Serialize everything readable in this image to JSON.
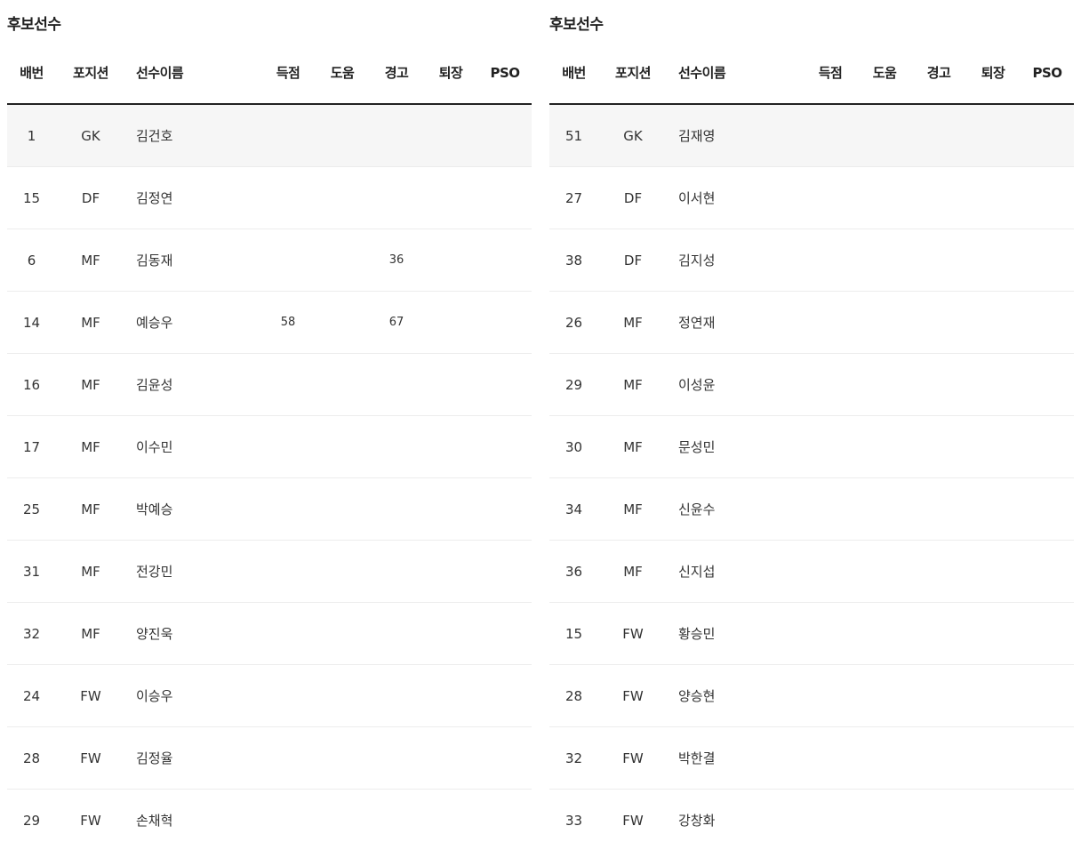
{
  "left": {
    "title": "후보선수",
    "columns": {
      "no": "배번",
      "position": "포지션",
      "name": "선수이름",
      "goal": "득점",
      "assist": "도움",
      "warning": "경고",
      "sendoff": "퇴장",
      "pso": "PSO"
    },
    "rows": [
      {
        "no": "1",
        "position": "GK",
        "name": "김건호",
        "goal": "",
        "assist": "",
        "warning": "",
        "sendoff": "",
        "pso": ""
      },
      {
        "no": "15",
        "position": "DF",
        "name": "김정연",
        "goal": "",
        "assist": "",
        "warning": "",
        "sendoff": "",
        "pso": ""
      },
      {
        "no": "6",
        "position": "MF",
        "name": "김동재",
        "goal": "",
        "assist": "",
        "warning": "36",
        "sendoff": "",
        "pso": ""
      },
      {
        "no": "14",
        "position": "MF",
        "name": "예승우",
        "goal": "58",
        "assist": "",
        "warning": "67",
        "sendoff": "",
        "pso": ""
      },
      {
        "no": "16",
        "position": "MF",
        "name": "김윤성",
        "goal": "",
        "assist": "",
        "warning": "",
        "sendoff": "",
        "pso": ""
      },
      {
        "no": "17",
        "position": "MF",
        "name": "이수민",
        "goal": "",
        "assist": "",
        "warning": "",
        "sendoff": "",
        "pso": ""
      },
      {
        "no": "25",
        "position": "MF",
        "name": "박예승",
        "goal": "",
        "assist": "",
        "warning": "",
        "sendoff": "",
        "pso": ""
      },
      {
        "no": "31",
        "position": "MF",
        "name": "전강민",
        "goal": "",
        "assist": "",
        "warning": "",
        "sendoff": "",
        "pso": ""
      },
      {
        "no": "32",
        "position": "MF",
        "name": "양진욱",
        "goal": "",
        "assist": "",
        "warning": "",
        "sendoff": "",
        "pso": ""
      },
      {
        "no": "24",
        "position": "FW",
        "name": "이승우",
        "goal": "",
        "assist": "",
        "warning": "",
        "sendoff": "",
        "pso": ""
      },
      {
        "no": "28",
        "position": "FW",
        "name": "김정율",
        "goal": "",
        "assist": "",
        "warning": "",
        "sendoff": "",
        "pso": ""
      },
      {
        "no": "29",
        "position": "FW",
        "name": "손채혁",
        "goal": "",
        "assist": "",
        "warning": "",
        "sendoff": "",
        "pso": ""
      }
    ]
  },
  "right": {
    "title": "후보선수",
    "columns": {
      "no": "배번",
      "position": "포지션",
      "name": "선수이름",
      "goal": "득점",
      "assist": "도움",
      "warning": "경고",
      "sendoff": "퇴장",
      "pso": "PSO"
    },
    "rows": [
      {
        "no": "51",
        "position": "GK",
        "name": "김재영",
        "goal": "",
        "assist": "",
        "warning": "",
        "sendoff": "",
        "pso": ""
      },
      {
        "no": "27",
        "position": "DF",
        "name": "이서현",
        "goal": "",
        "assist": "",
        "warning": "",
        "sendoff": "",
        "pso": ""
      },
      {
        "no": "38",
        "position": "DF",
        "name": "김지성",
        "goal": "",
        "assist": "",
        "warning": "",
        "sendoff": "",
        "pso": ""
      },
      {
        "no": "26",
        "position": "MF",
        "name": "정연재",
        "goal": "",
        "assist": "",
        "warning": "",
        "sendoff": "",
        "pso": ""
      },
      {
        "no": "29",
        "position": "MF",
        "name": "이성윤",
        "goal": "",
        "assist": "",
        "warning": "",
        "sendoff": "",
        "pso": ""
      },
      {
        "no": "30",
        "position": "MF",
        "name": "문성민",
        "goal": "",
        "assist": "",
        "warning": "",
        "sendoff": "",
        "pso": ""
      },
      {
        "no": "34",
        "position": "MF",
        "name": "신윤수",
        "goal": "",
        "assist": "",
        "warning": "",
        "sendoff": "",
        "pso": ""
      },
      {
        "no": "36",
        "position": "MF",
        "name": "신지섭",
        "goal": "",
        "assist": "",
        "warning": "",
        "sendoff": "",
        "pso": ""
      },
      {
        "no": "15",
        "position": "FW",
        "name": "황승민",
        "goal": "",
        "assist": "",
        "warning": "",
        "sendoff": "",
        "pso": ""
      },
      {
        "no": "28",
        "position": "FW",
        "name": "양승현",
        "goal": "",
        "assist": "",
        "warning": "",
        "sendoff": "",
        "pso": ""
      },
      {
        "no": "32",
        "position": "FW",
        "name": "박한결",
        "goal": "",
        "assist": "",
        "warning": "",
        "sendoff": "",
        "pso": ""
      },
      {
        "no": "33",
        "position": "FW",
        "name": "강창화",
        "goal": "",
        "assist": "",
        "warning": "",
        "sendoff": "",
        "pso": ""
      }
    ]
  }
}
